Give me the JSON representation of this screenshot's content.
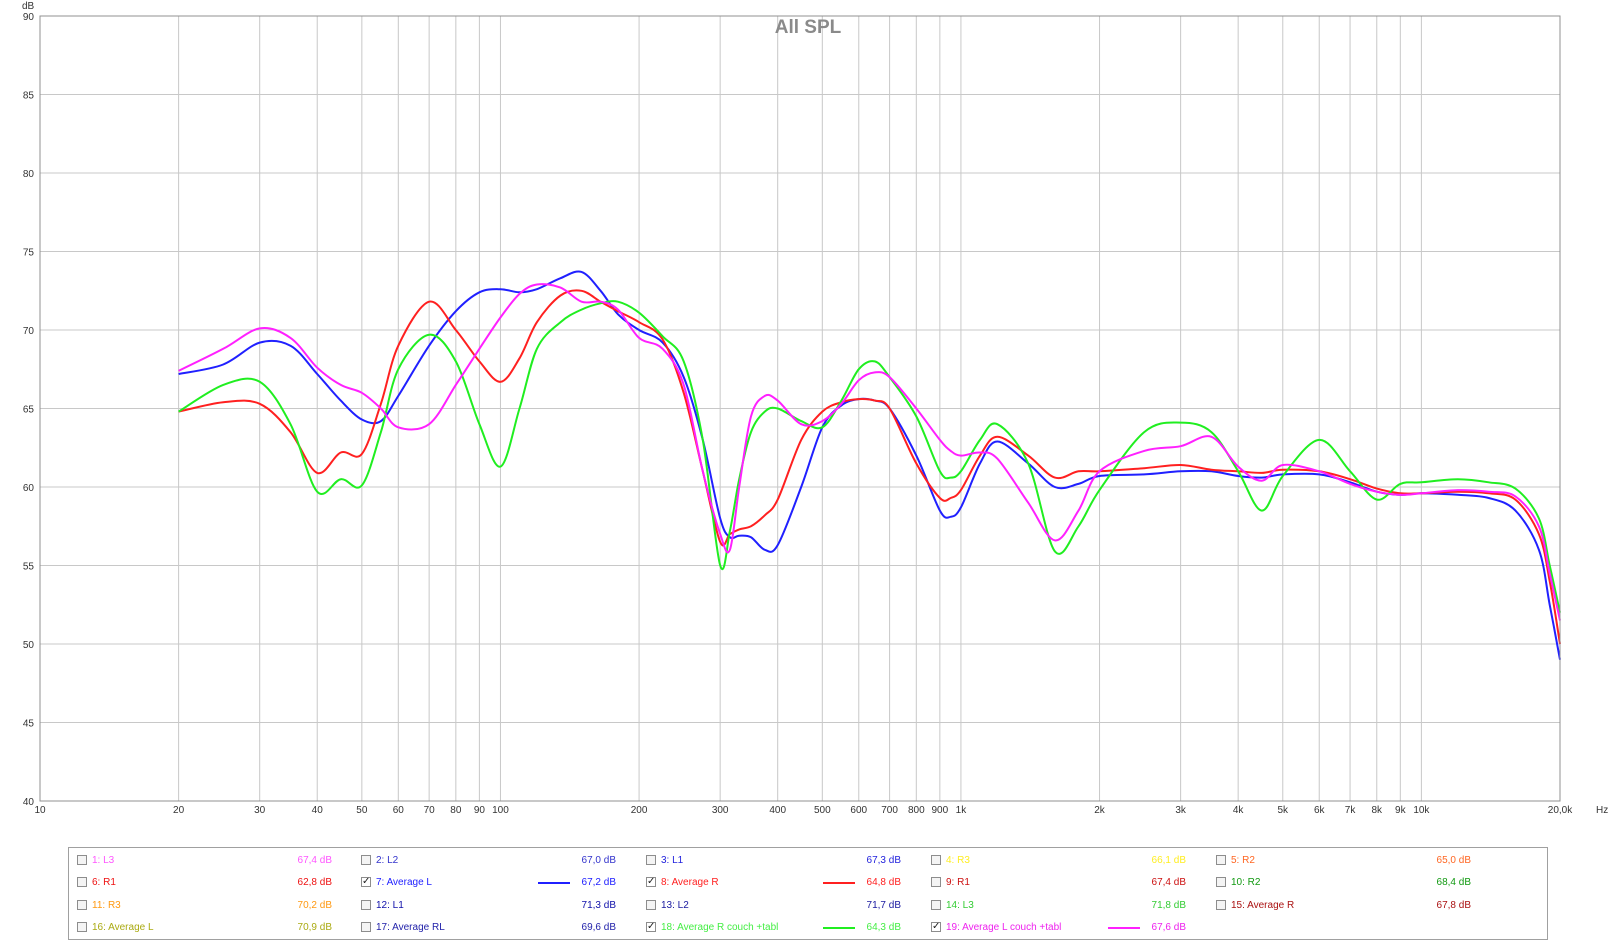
{
  "chart_data": {
    "type": "line",
    "title": "All SPL",
    "ylabel": "dB",
    "xunit": "Hz",
    "xscale": "log",
    "xlim": [
      10,
      20000
    ],
    "ylim": [
      40,
      90
    ],
    "grid": true,
    "y_ticks": [
      "40",
      "45",
      "50",
      "55",
      "60",
      "65",
      "70",
      "75",
      "80",
      "85",
      "90"
    ],
    "x_ticks": [
      {
        "v": 10,
        "t": "10"
      },
      {
        "v": 20,
        "t": "20"
      },
      {
        "v": 30,
        "t": "30"
      },
      {
        "v": 40,
        "t": "40"
      },
      {
        "v": 50,
        "t": "50"
      },
      {
        "v": 60,
        "t": "60"
      },
      {
        "v": 70,
        "t": "70"
      },
      {
        "v": 80,
        "t": "80"
      },
      {
        "v": 90,
        "t": "90"
      },
      {
        "v": 100,
        "t": "100"
      },
      {
        "v": 200,
        "t": "200"
      },
      {
        "v": 300,
        "t": "300"
      },
      {
        "v": 400,
        "t": "400"
      },
      {
        "v": 500,
        "t": "500"
      },
      {
        "v": 600,
        "t": "600"
      },
      {
        "v": 700,
        "t": "700"
      },
      {
        "v": 800,
        "t": "800"
      },
      {
        "v": 900,
        "t": "900"
      },
      {
        "v": 1000,
        "t": "1k"
      },
      {
        "v": 2000,
        "t": "2k"
      },
      {
        "v": 3000,
        "t": "3k"
      },
      {
        "v": 4000,
        "t": "4k"
      },
      {
        "v": 5000,
        "t": "5k"
      },
      {
        "v": 6000,
        "t": "6k"
      },
      {
        "v": 7000,
        "t": "7k"
      },
      {
        "v": 8000,
        "t": "8k"
      },
      {
        "v": 9000,
        "t": "9k"
      },
      {
        "v": 10000,
        "t": "10k"
      },
      {
        "v": 20000,
        "t": "20,0k"
      }
    ],
    "series": [
      {
        "name": "7: Average L",
        "color": "#2020ff",
        "x": [
          20,
          25,
          30,
          35,
          40,
          45,
          50,
          55,
          60,
          70,
          80,
          90,
          100,
          110,
          120,
          135,
          150,
          165,
          180,
          200,
          225,
          250,
          275,
          300,
          315,
          330,
          350,
          375,
          400,
          450,
          500,
          550,
          600,
          650,
          700,
          800,
          900,
          950,
          1000,
          1100,
          1200,
          1400,
          1600,
          1800,
          2000,
          2500,
          3000,
          3500,
          4000,
          4500,
          5000,
          6000,
          7000,
          8000,
          9000,
          10000,
          12000,
          14000,
          16000,
          18000,
          19000,
          20000
        ],
        "y": [
          67.2,
          67.8,
          69.2,
          69.0,
          67.2,
          65.5,
          64.3,
          64.2,
          65.8,
          69.0,
          71.2,
          72.4,
          72.6,
          72.4,
          72.6,
          73.3,
          73.7,
          72.5,
          71.0,
          70.0,
          69.2,
          67.0,
          63.0,
          58.0,
          56.8,
          56.9,
          56.8,
          56.0,
          56.3,
          60.0,
          63.8,
          65.2,
          65.6,
          65.5,
          65.0,
          62.0,
          58.5,
          58.1,
          58.7,
          61.5,
          62.9,
          61.5,
          60.0,
          60.2,
          60.7,
          60.8,
          61.0,
          61.0,
          60.7,
          60.6,
          60.8,
          60.8,
          60.3,
          59.7,
          59.5,
          59.6,
          59.5,
          59.3,
          58.5,
          56.0,
          52.5,
          49.0
        ]
      },
      {
        "name": "8: Average R",
        "color": "#ff2020",
        "x": [
          20,
          25,
          30,
          35,
          40,
          45,
          50,
          55,
          60,
          70,
          80,
          90,
          100,
          110,
          120,
          135,
          150,
          165,
          180,
          200,
          225,
          250,
          275,
          300,
          315,
          330,
          350,
          375,
          400,
          450,
          500,
          550,
          600,
          650,
          700,
          800,
          900,
          950,
          1000,
          1100,
          1200,
          1400,
          1600,
          1800,
          2000,
          2500,
          3000,
          3500,
          4000,
          4500,
          5000,
          6000,
          7000,
          8000,
          9000,
          10000,
          12000,
          14000,
          16000,
          18000,
          19000,
          20000
        ],
        "y": [
          64.8,
          65.4,
          65.3,
          63.5,
          60.9,
          62.2,
          62.1,
          65.3,
          69.0,
          71.8,
          70.0,
          68.0,
          66.7,
          68.2,
          70.5,
          72.2,
          72.5,
          71.8,
          71.2,
          70.5,
          69.4,
          66.0,
          61.0,
          56.5,
          57.0,
          57.3,
          57.5,
          58.2,
          59.2,
          63.0,
          64.8,
          65.4,
          65.6,
          65.5,
          65.0,
          61.5,
          59.3,
          59.3,
          59.8,
          62.0,
          63.2,
          62.0,
          60.6,
          61.0,
          61.0,
          61.2,
          61.4,
          61.1,
          61.0,
          60.9,
          61.1,
          61.0,
          60.5,
          59.9,
          59.6,
          59.6,
          59.7,
          59.6,
          59.2,
          57.0,
          54.0,
          50.0
        ]
      },
      {
        "name": "18: Average R couch +tabl",
        "color": "#20ee20",
        "x": [
          20,
          25,
          30,
          35,
          40,
          45,
          50,
          55,
          60,
          70,
          80,
          90,
          100,
          110,
          120,
          135,
          150,
          165,
          180,
          200,
          225,
          250,
          275,
          300,
          315,
          330,
          350,
          375,
          400,
          450,
          500,
          550,
          600,
          650,
          700,
          800,
          900,
          950,
          1000,
          1100,
          1200,
          1400,
          1600,
          1800,
          2000,
          2500,
          3000,
          3500,
          4000,
          4500,
          5000,
          6000,
          7000,
          8000,
          9000,
          10000,
          12000,
          14000,
          16000,
          18000,
          19000,
          20000
        ],
        "y": [
          64.8,
          66.5,
          66.7,
          64.0,
          59.7,
          60.5,
          60.1,
          63.5,
          67.5,
          69.7,
          68.0,
          64.0,
          61.3,
          65.0,
          68.8,
          70.5,
          71.3,
          71.7,
          71.8,
          71.1,
          69.6,
          68.0,
          63.0,
          55.0,
          57.2,
          60.5,
          63.5,
          64.8,
          65.0,
          64.2,
          63.8,
          65.5,
          67.5,
          68.0,
          67.0,
          64.5,
          61.0,
          60.6,
          61.0,
          63.0,
          64.0,
          61.5,
          55.9,
          57.5,
          59.8,
          63.5,
          64.1,
          63.5,
          61.0,
          58.5,
          60.7,
          63.0,
          61.0,
          59.2,
          60.2,
          60.3,
          60.5,
          60.3,
          59.9,
          58.0,
          55.0,
          52.0
        ]
      },
      {
        "name": "19: Average L couch +tabl",
        "color": "#ff20ff",
        "x": [
          20,
          25,
          30,
          35,
          40,
          45,
          50,
          55,
          60,
          70,
          80,
          90,
          100,
          110,
          120,
          135,
          150,
          165,
          180,
          200,
          225,
          250,
          275,
          300,
          315,
          330,
          350,
          375,
          400,
          450,
          500,
          550,
          600,
          650,
          700,
          800,
          900,
          950,
          1000,
          1100,
          1200,
          1400,
          1600,
          1800,
          2000,
          2500,
          3000,
          3500,
          4000,
          4500,
          5000,
          6000,
          7000,
          8000,
          9000,
          10000,
          12000,
          14000,
          16000,
          18000,
          19000,
          20000
        ],
        "y": [
          67.4,
          68.8,
          70.1,
          69.5,
          67.6,
          66.5,
          66.0,
          65.0,
          63.8,
          64.0,
          66.5,
          68.8,
          70.8,
          72.3,
          72.9,
          72.7,
          71.8,
          71.8,
          71.3,
          69.5,
          68.8,
          66.5,
          61.0,
          57.0,
          56.0,
          60.0,
          64.5,
          65.8,
          65.5,
          64.0,
          64.2,
          65.3,
          66.8,
          67.3,
          67.0,
          65.0,
          63.0,
          62.3,
          62.0,
          62.2,
          61.8,
          59.0,
          56.6,
          58.5,
          61.0,
          62.3,
          62.6,
          63.2,
          61.3,
          60.4,
          61.4,
          61.0,
          60.2,
          59.7,
          59.5,
          59.6,
          59.8,
          59.7,
          59.4,
          57.5,
          54.5,
          51.5
        ]
      }
    ]
  },
  "legend": {
    "items": [
      {
        "label": "1: L3",
        "value": "67,4 dB",
        "color": "#ff55ff",
        "checked": false
      },
      {
        "label": "2: L2",
        "value": "67,0 dB",
        "color": "#3333cc",
        "checked": false
      },
      {
        "label": "3: L1",
        "value": "67,3 dB",
        "color": "#2222dd",
        "checked": false
      },
      {
        "label": "4: R3",
        "value": "66,1 dB",
        "color": "#ffee22",
        "checked": false
      },
      {
        "label": "5: R2",
        "value": "65,0 dB",
        "color": "#ff6622",
        "checked": false
      },
      {
        "label": "6: R1",
        "value": "62,8 dB",
        "color": "#ee1111",
        "checked": false
      },
      {
        "label": "7: Average L",
        "value": "67,2 dB",
        "color": "#2020ff",
        "checked": true
      },
      {
        "label": "8: Average R",
        "value": "64,8 dB",
        "color": "#ff2020",
        "checked": true
      },
      {
        "label": "9: R1",
        "value": "67,4 dB",
        "color": "#cc1111",
        "checked": false
      },
      {
        "label": "10: R2",
        "value": "68,4 dB",
        "color": "#119911",
        "checked": false
      },
      {
        "label": "11: R3",
        "value": "70,2 dB",
        "color": "#ff9911",
        "checked": false
      },
      {
        "label": "12: L1",
        "value": "71,3 dB",
        "color": "#1111aa",
        "checked": false
      },
      {
        "label": "13: L2",
        "value": "71,7 dB",
        "color": "#1a1aa0",
        "checked": false
      },
      {
        "label": "14: L3",
        "value": "71,8 dB",
        "color": "#33cc33",
        "checked": false
      },
      {
        "label": "15: Average R",
        "value": "67,8 dB",
        "color": "#aa1111",
        "checked": false
      },
      {
        "label": "16: Average L",
        "value": "70,9 dB",
        "color": "#aaaa11",
        "checked": false
      },
      {
        "label": "17: Average RL",
        "value": "69,6 dB",
        "color": "#2222aa",
        "checked": false
      },
      {
        "label": "18: Average R couch +tabl",
        "value": "64,3 dB",
        "color": "#44ee44",
        "checked": true
      },
      {
        "label": "19: Average L couch +tabl",
        "value": "67,6 dB",
        "color": "#ee22ee",
        "checked": true
      }
    ]
  }
}
